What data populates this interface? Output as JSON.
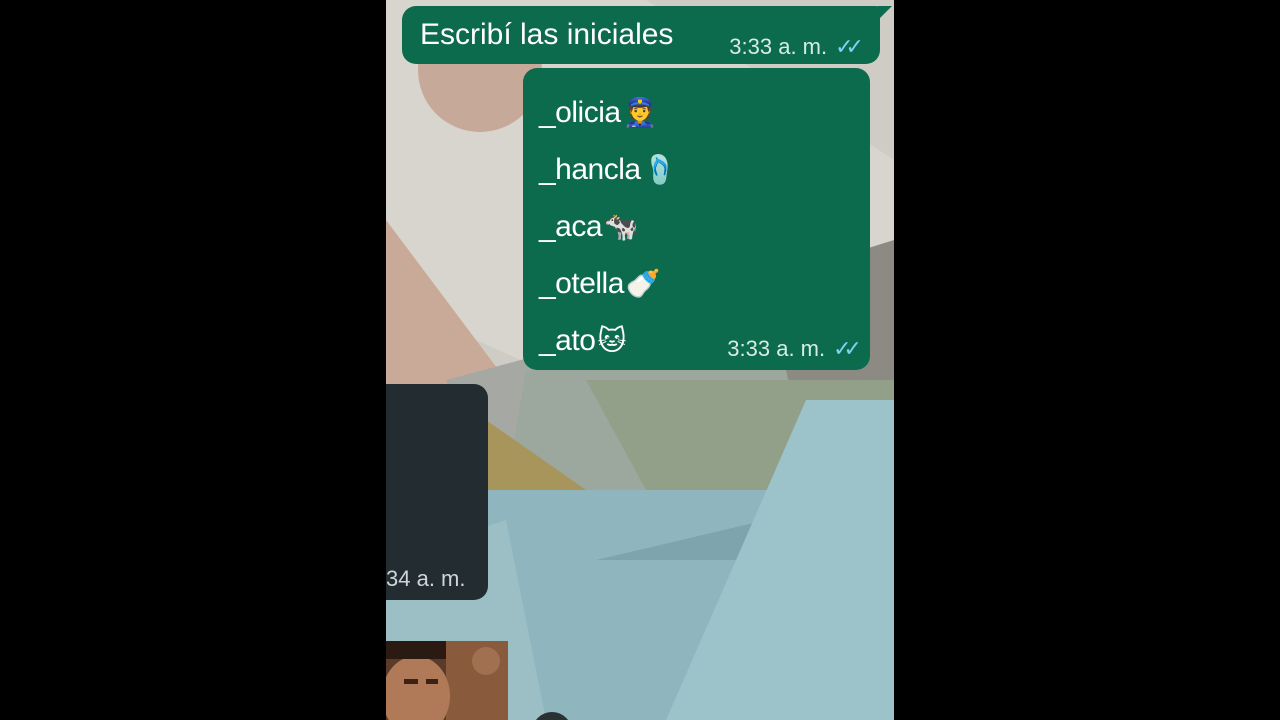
{
  "messages": [
    {
      "direction": "outgoing",
      "text": "Escribí las iniciales",
      "time": "3:33 a. m.",
      "status_icon": "double-check-read-icon"
    },
    {
      "direction": "outgoing",
      "lines": [
        {
          "text": "_olicia",
          "emoji": "👮",
          "emoji_name": "police-officer-emoji"
        },
        {
          "text": "_hancla",
          "emoji": "🩴",
          "emoji_name": "flip-flop-emoji"
        },
        {
          "text": "_aca",
          "emoji": "🐄",
          "emoji_name": "cow-emoji"
        },
        {
          "text": "_otella",
          "emoji": "🍼",
          "emoji_name": "baby-bottle-emoji"
        },
        {
          "text": "_ato",
          "emoji": "🐱",
          "emoji_name": "cat-face-emoji"
        }
      ],
      "time": "3:33 a. m.",
      "status_icon": "double-check-read-icon"
    },
    {
      "direction": "incoming",
      "time_partial": "34 a. m."
    }
  ],
  "colors": {
    "outgoing_bubble": "#0b6b4c",
    "incoming_bubble": "#232d31",
    "read_ticks": "#7fd0f4",
    "letterbox": "#000000"
  }
}
